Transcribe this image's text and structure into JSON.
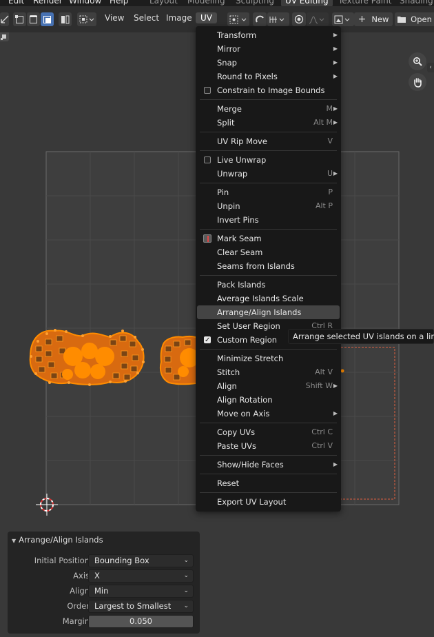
{
  "top_menubar": {
    "menus": [
      "Edit",
      "Render",
      "Window",
      "Help"
    ],
    "workspaces": [
      "Layout",
      "Modeling",
      "Sculpting",
      "UV Editing",
      "Texture Paint",
      "Shading"
    ],
    "active_workspace": "UV Editing"
  },
  "header": {
    "menus": [
      "View",
      "Select",
      "Image",
      "UV"
    ],
    "open_menu": "UV",
    "new_label": "New",
    "open_label": "Open"
  },
  "uv_menu": {
    "items": [
      {
        "label": "Transform",
        "submenu": true
      },
      {
        "label": "Mirror",
        "submenu": true
      },
      {
        "label": "Snap",
        "submenu": true
      },
      {
        "label": "Round to Pixels",
        "submenu": true
      },
      {
        "label": "Constrain to Image Bounds",
        "checkbox": false
      },
      {
        "sep": true
      },
      {
        "label": "Merge",
        "shortcut": "M",
        "submenu": true
      },
      {
        "label": "Split",
        "shortcut": "Alt M",
        "submenu": true
      },
      {
        "sep": true
      },
      {
        "label": "UV Rip Move",
        "shortcut": "V"
      },
      {
        "sep": true
      },
      {
        "label": "Live Unwrap",
        "checkbox": false
      },
      {
        "label": "Unwrap",
        "shortcut": "U",
        "submenu": true
      },
      {
        "sep": true
      },
      {
        "label": "Pin",
        "shortcut": "P"
      },
      {
        "label": "Unpin",
        "shortcut": "Alt P"
      },
      {
        "label": "Invert Pins"
      },
      {
        "sep": true
      },
      {
        "label": "Mark Seam",
        "seam_icon": true
      },
      {
        "label": "Clear Seam"
      },
      {
        "label": "Seams from Islands"
      },
      {
        "sep": true
      },
      {
        "label": "Pack Islands"
      },
      {
        "label": "Average Islands Scale"
      },
      {
        "label": "Arrange/Align Islands",
        "highlighted": true
      },
      {
        "label": "Set User Region",
        "shortcut": "Ctrl R"
      },
      {
        "label": "Custom Region",
        "checkbox": true
      },
      {
        "sep": true
      },
      {
        "label": "Minimize Stretch"
      },
      {
        "label": "Stitch",
        "shortcut": "Alt V"
      },
      {
        "label": "Align",
        "shortcut": "Shift W",
        "submenu": true
      },
      {
        "label": "Align Rotation"
      },
      {
        "label": "Move on Axis",
        "submenu": true
      },
      {
        "sep": true
      },
      {
        "label": "Copy UVs",
        "shortcut": "Ctrl C"
      },
      {
        "label": "Paste UVs",
        "shortcut": "Ctrl V"
      },
      {
        "sep": true
      },
      {
        "label": "Show/Hide Faces",
        "submenu": true
      },
      {
        "sep": true
      },
      {
        "label": "Reset"
      },
      {
        "sep": true
      },
      {
        "label": "Export UV Layout"
      }
    ]
  },
  "tooltip": {
    "text": "Arrange selected UV islands on a line."
  },
  "operator_panel": {
    "title": "Arrange/Align Islands",
    "rows": [
      {
        "label": "Initial Position",
        "value": "Bounding Box",
        "type": "enum"
      },
      {
        "label": "Axis",
        "value": "X",
        "type": "enum"
      },
      {
        "label": "Align",
        "value": "Min",
        "type": "enum"
      },
      {
        "label": "Order",
        "value": "Largest to Smallest",
        "type": "enum"
      },
      {
        "label": "Margin",
        "value": "0.050",
        "type": "number"
      }
    ]
  },
  "icons": {
    "viewport_tools": [
      "zoom-icon",
      "hand-pan-icon"
    ],
    "cursor": "2d-cursor-icon"
  },
  "colors": {
    "accent": "#4772b3",
    "uv_selected": "#ff8c00",
    "menu_bg": "#181818",
    "viewport_bg": "#393939"
  }
}
